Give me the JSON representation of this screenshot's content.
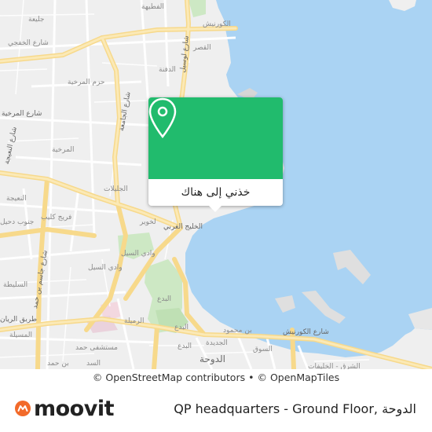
{
  "map": {
    "labels": {
      "jelaiah": "جليعة",
      "fatahiya": "الفطيهة",
      "cornish_top": "الكورنيش",
      "qasr": "القصر",
      "street_khafji": "شارع الخفجي",
      "hazm_markhiya": "حزم المرخية",
      "street_markhiya": "شارع المرخية",
      "markhiya": "المرخية",
      "street_jamea": "شارع الجامعة",
      "street_lusail_1": "شارع لوسيل",
      "dafna": "الدفنة",
      "nuaija": "النعيجة",
      "jalilat": "الجليلات",
      "khuwair": "لخوير",
      "fariq_kulaib": "فريج كليب",
      "south_duhail": "جنوب دحيل",
      "west_bay": "الخليج الغربي",
      "wadi_sail_1": "وادي السيل",
      "wadi_sail_2": "وادي السيل",
      "sulaitah": "السليطة",
      "road_rayyan": "طريق الريان",
      "street_jassim": "شارع جاسم بن حمد",
      "street_nuaija": "شارع النعيجة",
      "bidda_1": "البدع",
      "bidda_2": "البدع",
      "bidda_3": "البدع",
      "rumaila": "الرميلة",
      "musaila": "المسيلة",
      "jadeeda": "الجديدة",
      "bin_mahmoud": "بن محمود",
      "hamad_hospital": "مستشفى حمد",
      "souq": "السوق",
      "doha": "الدوحة",
      "corniche_street": "شارع الكورنيش",
      "east_gulf": "الشرق - الخليفات",
      "bn_hamad": "بن حمد",
      "sadd": "السد"
    },
    "popup": {
      "button_label": "خذني إلى هناك",
      "pin_icon": "map-pin-icon"
    },
    "colors": {
      "water": "#aad3f3",
      "land": "#efefef",
      "road_major": "#fbe5a3",
      "park": "#cde8c4",
      "popup_green": "#21bb6d",
      "brand_orange": "#f26a2a"
    }
  },
  "attribution": {
    "copyright": "©",
    "osm_contributors": "OpenStreetMap contributors",
    "bullet": "•",
    "copyright2": "©",
    "openmaptiles": "OpenMapTiles"
  },
  "footer": {
    "logo_text": "moovit",
    "logo_icon": "moovit-logo-icon",
    "place_name": "QP headquarters - Ground Floor, الدوحة"
  }
}
